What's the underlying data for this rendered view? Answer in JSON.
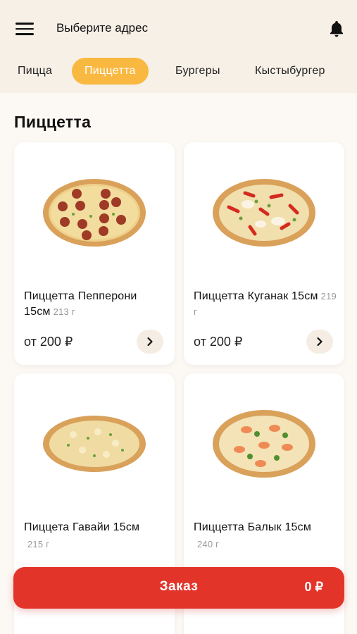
{
  "header": {
    "address_label": "Выберите адрес"
  },
  "tabs": [
    {
      "label": "Пицца",
      "active": false
    },
    {
      "label": "Пиццетта",
      "active": true
    },
    {
      "label": "Бургеры",
      "active": false
    },
    {
      "label": "Кыстыбургер",
      "active": false
    }
  ],
  "section": {
    "title": "Пиццетта"
  },
  "products": [
    {
      "name": "Пиццетта Пепперони 15см",
      "weight": "213 г",
      "price": "от 200 ₽",
      "image": "pepperoni-pizza"
    },
    {
      "name": "Пиццетта Куганак 15см",
      "weight": "219 г",
      "price": "от 200 ₽",
      "image": "kuganak-pizza"
    },
    {
      "name": "Пиццета Гавайи 15см",
      "weight": "215 г",
      "image": "hawaii-pizza"
    },
    {
      "name": "Пиццетта Балык 15см",
      "weight": "240 г",
      "image": "balyk-pizza"
    }
  ],
  "order": {
    "label": "Заказ",
    "total": "0 ₽"
  },
  "colors": {
    "accent": "#f9b840",
    "order": "#e3342a",
    "header_bg": "#f7f0e7",
    "page_bg": "#fcf8f3"
  }
}
